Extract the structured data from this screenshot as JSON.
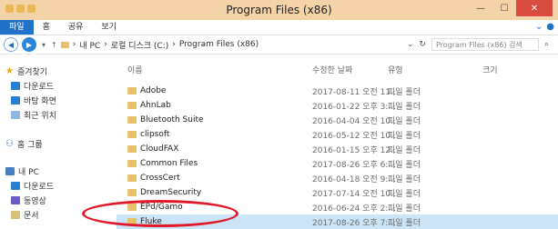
{
  "window": {
    "title": "Program Files (x86)"
  },
  "ribbon": {
    "tabs": [
      "파일",
      "홈",
      "공유",
      "보기"
    ]
  },
  "address": {
    "path": [
      "내 PC",
      "로컬 디스크 (C:)",
      "Program Files (x86)"
    ],
    "search_placeholder": "Program Files (x86) 검색"
  },
  "nav": {
    "favorites": "즐겨찾기",
    "downloads": "다운로드",
    "desktop": "바탕 화면",
    "recent": "최근 위치",
    "homegroup": "홈 그룹",
    "pc": "내 PC",
    "pc_downloads": "다운로드",
    "videos": "동영상",
    "documents": "문서"
  },
  "columns": {
    "name": "이름",
    "date": "수정한 날짜",
    "type": "유형",
    "size": "크기"
  },
  "files": [
    {
      "name": "Adobe",
      "date": "2017-08-11 오전 11...",
      "type": "파일 폴더"
    },
    {
      "name": "AhnLab",
      "date": "2016-01-22 오후 3:...",
      "type": "파일 폴더"
    },
    {
      "name": "Bluetooth Suite",
      "date": "2016-04-04 오전 10...",
      "type": "파일 폴더"
    },
    {
      "name": "clipsoft",
      "date": "2016-05-12 오전 10...",
      "type": "파일 폴더"
    },
    {
      "name": "CloudFAX",
      "date": "2016-01-15 오후 12...",
      "type": "파일 폴더"
    },
    {
      "name": "Common Files",
      "date": "2017-08-26 오후 6:...",
      "type": "파일 폴더"
    },
    {
      "name": "CrossCert",
      "date": "2016-04-18 오전 9:...",
      "type": "파일 폴더"
    },
    {
      "name": "DreamSecurity",
      "date": "2017-07-14 오전 10...",
      "type": "파일 폴더"
    },
    {
      "name": "EPd/Gamo",
      "date": "2016-06-24 오후 2:...",
      "type": "파일 폴더"
    },
    {
      "name": "Fluke",
      "date": "2017-08-26 오후 7:...",
      "type": "파일 폴더"
    }
  ],
  "selected_file": "Fluke",
  "annotation_color": "#e3172a"
}
